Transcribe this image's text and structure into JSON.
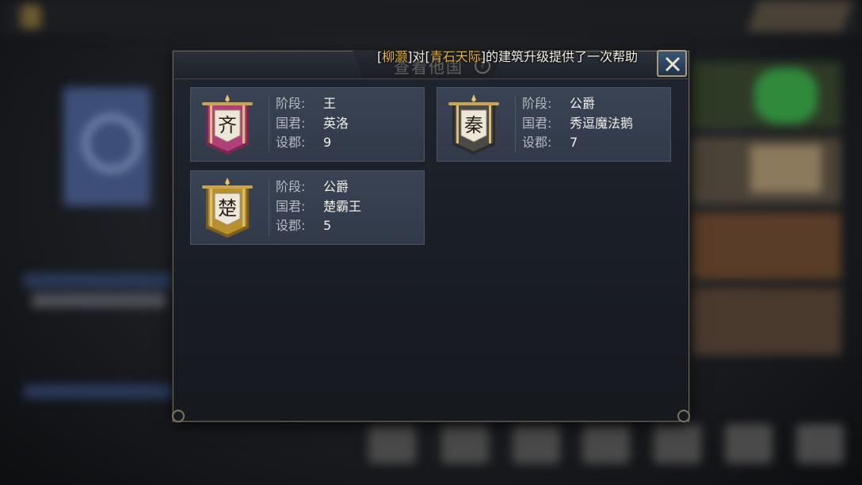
{
  "background": {
    "blurred": true
  },
  "notice": {
    "prefix_open": "[",
    "player": "柳灏",
    "mid_1": "]对[",
    "target": "青石天际",
    "suffix": "]的建筑升级提供了一次帮助"
  },
  "dialog": {
    "title": "查看他国",
    "help_symbol": "?",
    "close_icon": "close-icon"
  },
  "labels": {
    "stage": "阶段:",
    "monarch": "国君:",
    "counties": "设郡:"
  },
  "countries": [
    {
      "char": "齐",
      "stage": "王",
      "monarch": "英洛",
      "counties": "9",
      "color": "#b0407c",
      "trim": "#7a2850"
    },
    {
      "char": "秦",
      "stage": "公爵",
      "monarch": "秀逗魔法鹅",
      "counties": "7",
      "color": "#4c4a48",
      "trim": "#2e2c2a"
    },
    {
      "char": "楚",
      "stage": "公爵",
      "monarch": "楚霸王",
      "counties": "5",
      "color": "#b8902e",
      "trim": "#7d5f1a"
    }
  ]
}
